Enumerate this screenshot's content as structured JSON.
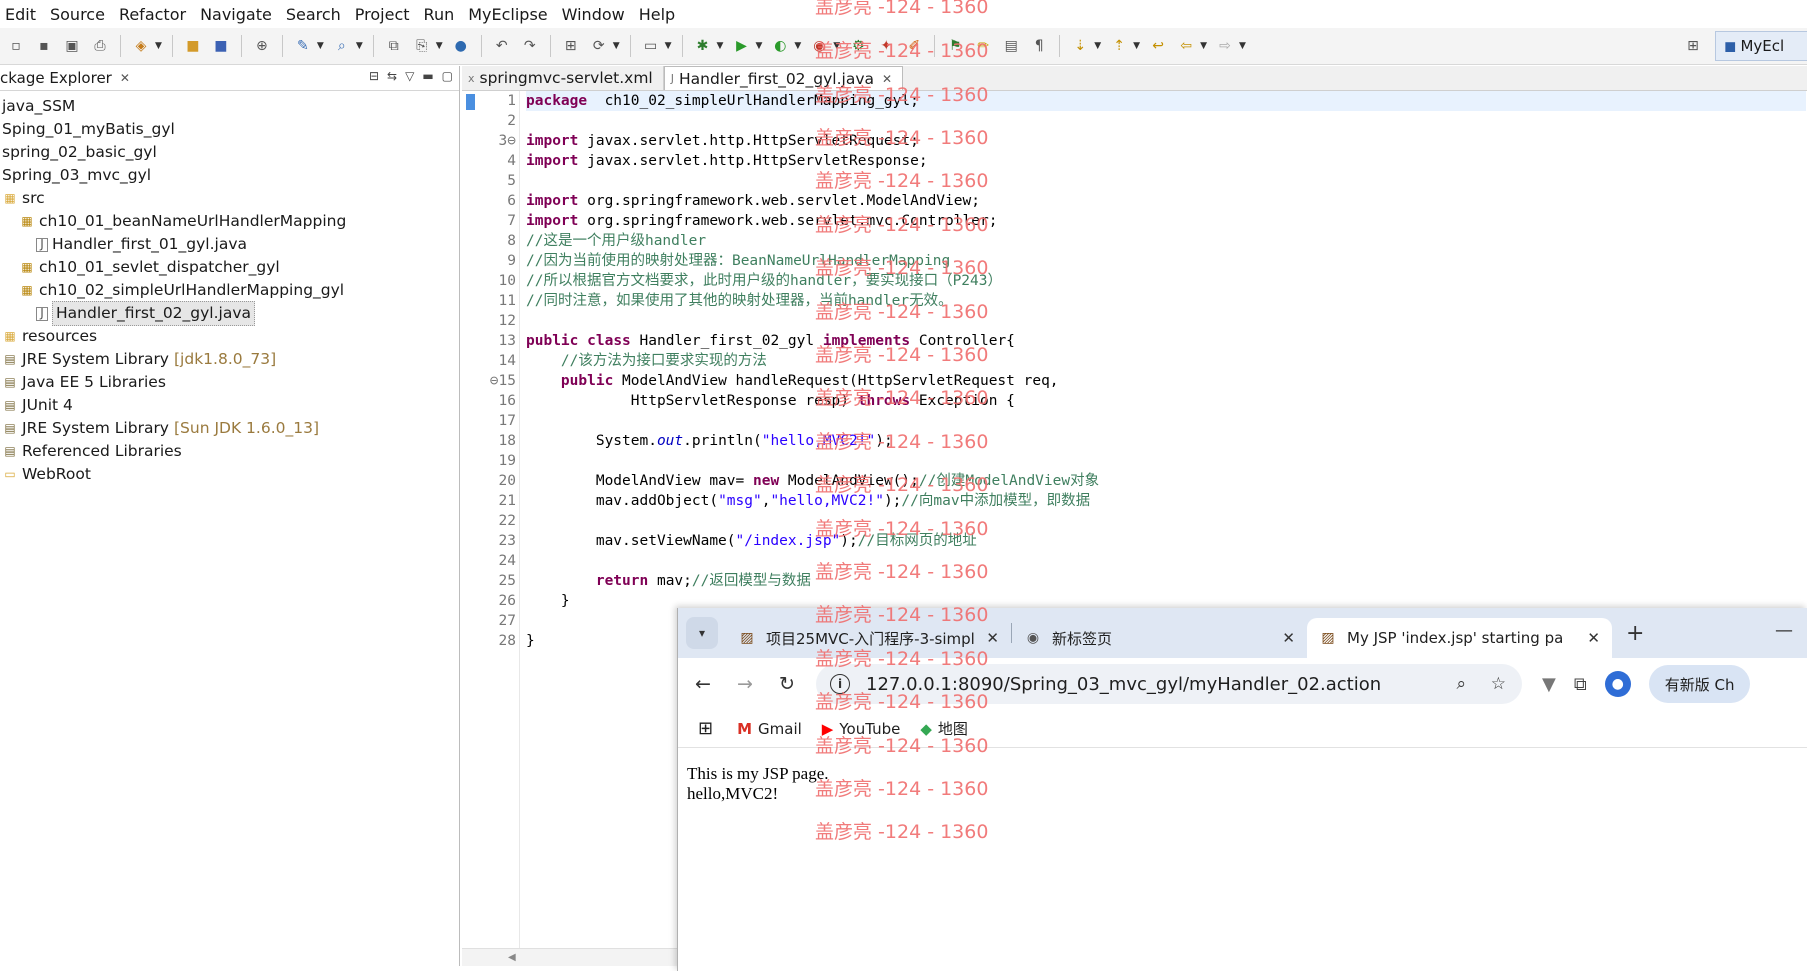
{
  "menu": [
    "Edit",
    "Source",
    "Refactor",
    "Navigate",
    "Search",
    "Project",
    "Run",
    "MyEclipse",
    "Window",
    "Help"
  ],
  "toolbar": {
    "perspective_label": "MyEcl"
  },
  "package_explorer": {
    "tab_label": "ckage Explorer",
    "items": [
      {
        "label": "java_SSM",
        "indent": 0,
        "icon": "project-icon",
        "tag": ""
      },
      {
        "label": "Sping_01_myBatis_gyl",
        "indent": 0,
        "icon": "project-icon",
        "tag": ""
      },
      {
        "label": "spring_02_basic_gyl",
        "indent": 0,
        "icon": "project-icon",
        "tag": ""
      },
      {
        "label": "Spring_03_mvc_gyl",
        "indent": 0,
        "icon": "project-icon",
        "tag": ""
      },
      {
        "label": "src",
        "indent": 0,
        "icon": "source-folder-icon",
        "tag": ""
      },
      {
        "label": "ch10_01_beanNameUrlHandlerMapping",
        "indent": 1,
        "icon": "package-icon",
        "tag": ""
      },
      {
        "label": "Handler_first_01_gyl.java",
        "indent": 2,
        "icon": "java-file-icon",
        "tag": ""
      },
      {
        "label": "ch10_01_sevlet_dispatcher_gyl",
        "indent": 1,
        "icon": "package-icon",
        "tag": ""
      },
      {
        "label": "ch10_02_simpleUrlHandlerMapping_gyl",
        "indent": 1,
        "icon": "package-icon",
        "tag": ""
      },
      {
        "label": "Handler_first_02_gyl.java",
        "indent": 2,
        "icon": "java-file-icon",
        "tag": "",
        "selected": true
      },
      {
        "label": "resources",
        "indent": 0,
        "icon": "source-folder-icon",
        "tag": ""
      },
      {
        "label": "JRE System Library",
        "indent": 0,
        "icon": "library-icon",
        "tag": "[jdk1.8.0_73]"
      },
      {
        "label": "Java EE 5 Libraries",
        "indent": 0,
        "icon": "library-icon",
        "tag": ""
      },
      {
        "label": "JUnit 4",
        "indent": 0,
        "icon": "library-icon",
        "tag": ""
      },
      {
        "label": "JRE System Library",
        "indent": 0,
        "icon": "library-icon",
        "tag": "[Sun JDK 1.6.0_13]"
      },
      {
        "label": "Referenced Libraries",
        "indent": 0,
        "icon": "library-icon",
        "tag": ""
      },
      {
        "label": "WebRoot",
        "indent": 0,
        "icon": "folder-icon",
        "tag": ""
      }
    ]
  },
  "editor": {
    "tabs": [
      {
        "label": "springmvc-servlet.xml",
        "active": false
      },
      {
        "label": "Handler_first_02_gyl.java",
        "active": true
      }
    ],
    "line_numbers": [
      "1",
      "2",
      "3⊖",
      "4",
      "5",
      "6",
      "7",
      "8",
      "9",
      "10",
      "11",
      "12",
      "13",
      "14",
      "⊖15",
      "16",
      "17",
      "18",
      "19",
      "20",
      "21",
      "22",
      "23",
      "24",
      "25",
      "26",
      "27",
      "28"
    ],
    "lines": [
      [
        [
          "kw",
          "package"
        ],
        [
          "",
          "  ch10_02_simpleUrlHandlerMapping_gyl;"
        ]
      ],
      [],
      [
        [
          "kw",
          "import"
        ],
        [
          "",
          " javax.servlet.http.HttpServletRequest;"
        ]
      ],
      [
        [
          "kw",
          "import"
        ],
        [
          "",
          " javax.servlet.http.HttpServletResponse;"
        ]
      ],
      [],
      [
        [
          "kw",
          "import"
        ],
        [
          "",
          " org.springframework.web.servlet.ModelAndView;"
        ]
      ],
      [
        [
          "kw",
          "import"
        ],
        [
          "",
          " org.springframework.web.servlet.mvc.Controller;"
        ]
      ],
      [
        [
          "cm",
          "//这是一个用户级handler"
        ]
      ],
      [
        [
          "cm",
          "//因为当前使用的映射处理器：BeanNameUrlHandlerMapping"
        ]
      ],
      [
        [
          "cm",
          "//所以根据官方文档要求，此时用户级的handler，要实现接口（P243）"
        ]
      ],
      [
        [
          "cm",
          "//同时注意，如果使用了其他的映射处理器，当前handler无效。"
        ]
      ],
      [],
      [
        [
          "kw",
          "public"
        ],
        [
          "",
          " "
        ],
        [
          "kw",
          "class"
        ],
        [
          "",
          " Handler_first_02_gyl "
        ],
        [
          "kw",
          "implements"
        ],
        [
          "",
          " Controller{"
        ]
      ],
      [
        [
          "",
          "    "
        ],
        [
          "cm",
          "//该方法为接口要求实现的方法"
        ]
      ],
      [
        [
          "",
          "    "
        ],
        [
          "kw",
          "public"
        ],
        [
          "",
          " ModelAndView handleRequest(HttpServletRequest req,"
        ]
      ],
      [
        [
          "",
          "            HttpServletResponse resp) "
        ],
        [
          "kw",
          "throws"
        ],
        [
          "",
          " Exception {"
        ]
      ],
      [],
      [
        [
          "",
          "        System."
        ],
        [
          "it",
          "out"
        ],
        [
          "",
          ".println("
        ],
        [
          "str",
          "\"hello,MVC2!\""
        ],
        [
          "",
          ");"
        ]
      ],
      [],
      [
        [
          "",
          "        ModelAndView mav= "
        ],
        [
          "kw",
          "new"
        ],
        [
          "",
          " ModelAndView();"
        ],
        [
          "cm",
          "//创建ModelAndView对象"
        ]
      ],
      [
        [
          "",
          "        mav.addObject("
        ],
        [
          "str",
          "\"msg\""
        ],
        [
          "",
          ","
        ],
        [
          "str",
          "\"hello,MVC2!\""
        ],
        [
          "",
          ");"
        ],
        [
          "cm",
          "//向mav中添加模型，即数据"
        ]
      ],
      [],
      [
        [
          "",
          "        mav.setViewName("
        ],
        [
          "str",
          "\"/index.jsp\""
        ],
        [
          "",
          ");"
        ],
        [
          "cm",
          "//目标网页的地址"
        ]
      ],
      [],
      [
        [
          "",
          "        "
        ],
        [
          "kw",
          "return"
        ],
        [
          "",
          " mav;"
        ],
        [
          "cm",
          "//返回模型与数据"
        ]
      ],
      [
        [
          "",
          "    }"
        ]
      ],
      [],
      [
        [
          "",
          "}"
        ]
      ]
    ]
  },
  "browser": {
    "tabs": [
      {
        "title": "项目25MVC-入门程序-3-simpl",
        "icon": "page-favicon-icon"
      },
      {
        "title": "新标签页",
        "icon": "chrome-icon"
      },
      {
        "title": "My JSP 'index.jsp' starting pa",
        "icon": "page-favicon-icon",
        "active": true
      }
    ],
    "url": "127.0.0.1:8090/Spring_03_mvc_gyl/myHandler_02.action",
    "new_version_label": "有新版 Ch",
    "bookmarks": [
      {
        "label": "Gmail",
        "icon": "gmail-icon"
      },
      {
        "label": "YouTube",
        "icon": "youtube-icon"
      },
      {
        "label": "地图",
        "icon": "maps-icon"
      }
    ],
    "page_lines": [
      "This is my JSP page.",
      "hello,MVC2!"
    ]
  },
  "watermark": "盖彦亮 -124 - 1360"
}
